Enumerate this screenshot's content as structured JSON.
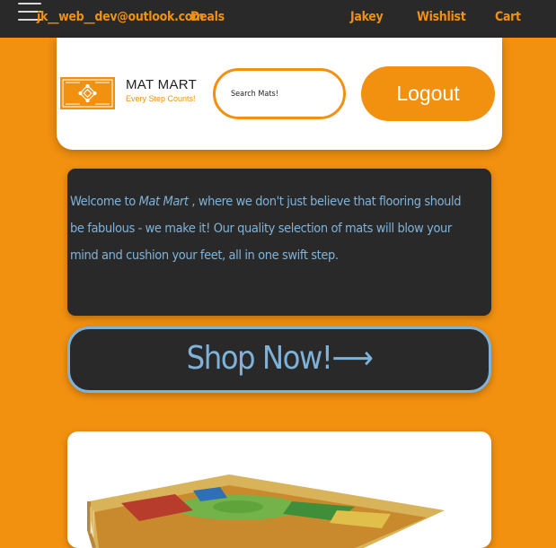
{
  "topbar": {
    "menu_icon": "hamburger-menu-icon",
    "email": "jk__web__dev@outlook.com",
    "deals": "Deals",
    "user": "Jakey",
    "wishlist": "Wishlist",
    "cart": "Cart"
  },
  "header": {
    "brand_name": "MAT MART",
    "tagline": "Every Step Counts!",
    "search_placeholder": "Search Mats!",
    "logout_label": "Logout"
  },
  "welcome": {
    "before": "Welcome to ",
    "brand": "Mat Mart",
    "after": " , where we don't just believe that flooring should be fabulous - we make it! Our quality selection of mats will blow your mind and cushion your feet, all in one swift step."
  },
  "shop": {
    "label": "Shop Now!",
    "arrow": "⟶"
  },
  "colors": {
    "accent": "#f2900f",
    "dark": "#292929",
    "text_blue": "#7fb2d8"
  }
}
